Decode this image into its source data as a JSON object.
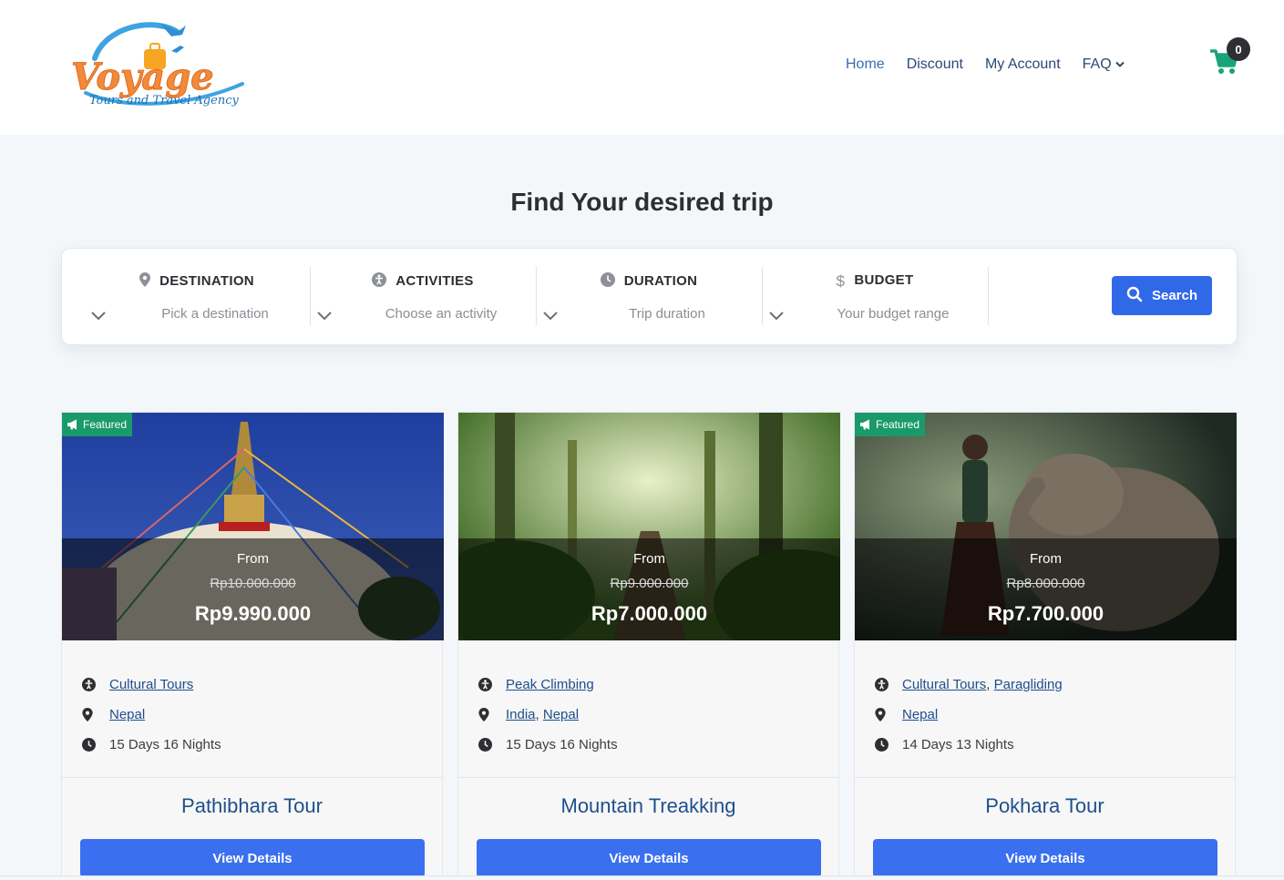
{
  "brand": {
    "logo_text": "Voyage",
    "logo_tagline": "Tours and Travel Agency"
  },
  "nav": {
    "items": [
      "Home",
      "Discount",
      "My Account"
    ],
    "faq": "FAQ"
  },
  "cart": {
    "count": "0"
  },
  "hero": {
    "title": "Find Your desired trip"
  },
  "search": {
    "fields": [
      {
        "label": "DESTINATION",
        "placeholder": "Pick a destination",
        "icon": "map-marker-icon"
      },
      {
        "label": "ACTIVITIES",
        "placeholder": "Choose an activity",
        "icon": "accessibility-icon"
      },
      {
        "label": "DURATION",
        "placeholder": "Trip duration",
        "icon": "clock-icon"
      },
      {
        "label": "BUDGET",
        "placeholder": "Your budget range",
        "icon": "dollar-icon"
      }
    ],
    "button": "Search"
  },
  "cards": [
    {
      "featured": "Featured",
      "from": "From",
      "old_price": "Rp10.000.000",
      "price": "Rp9.990.000",
      "activities": [
        "Cultural Tours"
      ],
      "locations": [
        "Nepal"
      ],
      "duration": "15 Days 16 Nights",
      "title": "Pathibhara Tour",
      "button": "View Details"
    },
    {
      "featured": "",
      "from": "From",
      "old_price": "Rp9.000.000",
      "price": "Rp7.000.000",
      "activities": [
        "Peak Climbing"
      ],
      "locations": [
        "India",
        "Nepal"
      ],
      "duration": "15 Days 16 Nights",
      "title": "Mountain Treakking",
      "button": "View Details"
    },
    {
      "featured": "Featured",
      "from": "From",
      "old_price": "Rp8.000.000",
      "price": "Rp7.700.000",
      "activities": [
        "Cultural Tours",
        "Paragliding"
      ],
      "locations": [
        "Nepal"
      ],
      "duration": "14 Days 13 Nights",
      "title": "Pokhara Tour",
      "button": "View Details"
    }
  ],
  "colors": {
    "primary": "#3069e7",
    "featured": "#1a9a6a",
    "cart": "#1aa37a",
    "heading": "#2c2e33",
    "link": "#1f4d8c"
  }
}
